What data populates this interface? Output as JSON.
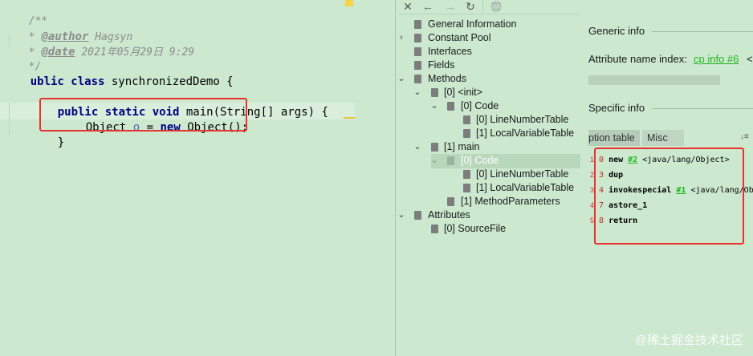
{
  "editor": {
    "doc_open": "/**",
    "author_tag": "@author",
    "author_value": "Hagsyn",
    "date_tag": "@date",
    "date_value": "2021年05月29日 9:29",
    "doc_close": "*/",
    "class_decl": {
      "kw": "ublic class",
      "name": " synchronizedDemo {"
    },
    "method_decl": {
      "kw": "public static void",
      "rest": " main(String[] args) {"
    },
    "statement": {
      "type": "Object ",
      "var": "o",
      "eq": " = ",
      "kw": "new",
      "rest": " Object();"
    },
    "method_close": "}"
  },
  "toolbar": {
    "close": "✕",
    "back": "←",
    "forward": "→",
    "refresh": "↻",
    "web": "🌐"
  },
  "tree": {
    "general_information": "General Information",
    "constant_pool": "Constant Pool",
    "interfaces": "Interfaces",
    "fields": "Fields",
    "methods": "Methods",
    "init": "[0] <init>",
    "init_code": "[0] Code",
    "init_lnt": "[0] LineNumberTable",
    "init_lvt": "[1] LocalVariableTable",
    "main": "[1] main",
    "main_code": "[0] Code",
    "main_lnt": "[0] LineNumberTable",
    "main_lvt": "[1] LocalVariableTable",
    "method_params": "[1] MethodParameters",
    "attributes": "Attributes",
    "sourcefile": "[0] SourceFile"
  },
  "info": {
    "generic_info": "Generic info",
    "attr_name_index_label": "Attribute name index:",
    "attr_name_index_value": "cp info #6",
    "attr_name_index_suffix": "<",
    "specific_info": "Specific info",
    "tab_exception_table": "ption table",
    "tab_misc": "Misc",
    "sort_icon": "↓≡"
  },
  "bytecode": [
    {
      "line": "1",
      "offset": "0",
      "op": "new",
      "ref": "#2",
      "comment": " <java/lang/Object>"
    },
    {
      "line": "2",
      "offset": "3",
      "op": "dup",
      "ref": "",
      "comment": ""
    },
    {
      "line": "3",
      "offset": "4",
      "op": "invokespecial",
      "ref": "#1",
      "comment": " <java/lang/Ob"
    },
    {
      "line": "4",
      "offset": "7",
      "op": "astore_1",
      "ref": "",
      "comment": ""
    },
    {
      "line": "5",
      "offset": "8",
      "op": "return",
      "ref": "",
      "comment": ""
    }
  ],
  "watermark": "@稀土掘金技术社区"
}
